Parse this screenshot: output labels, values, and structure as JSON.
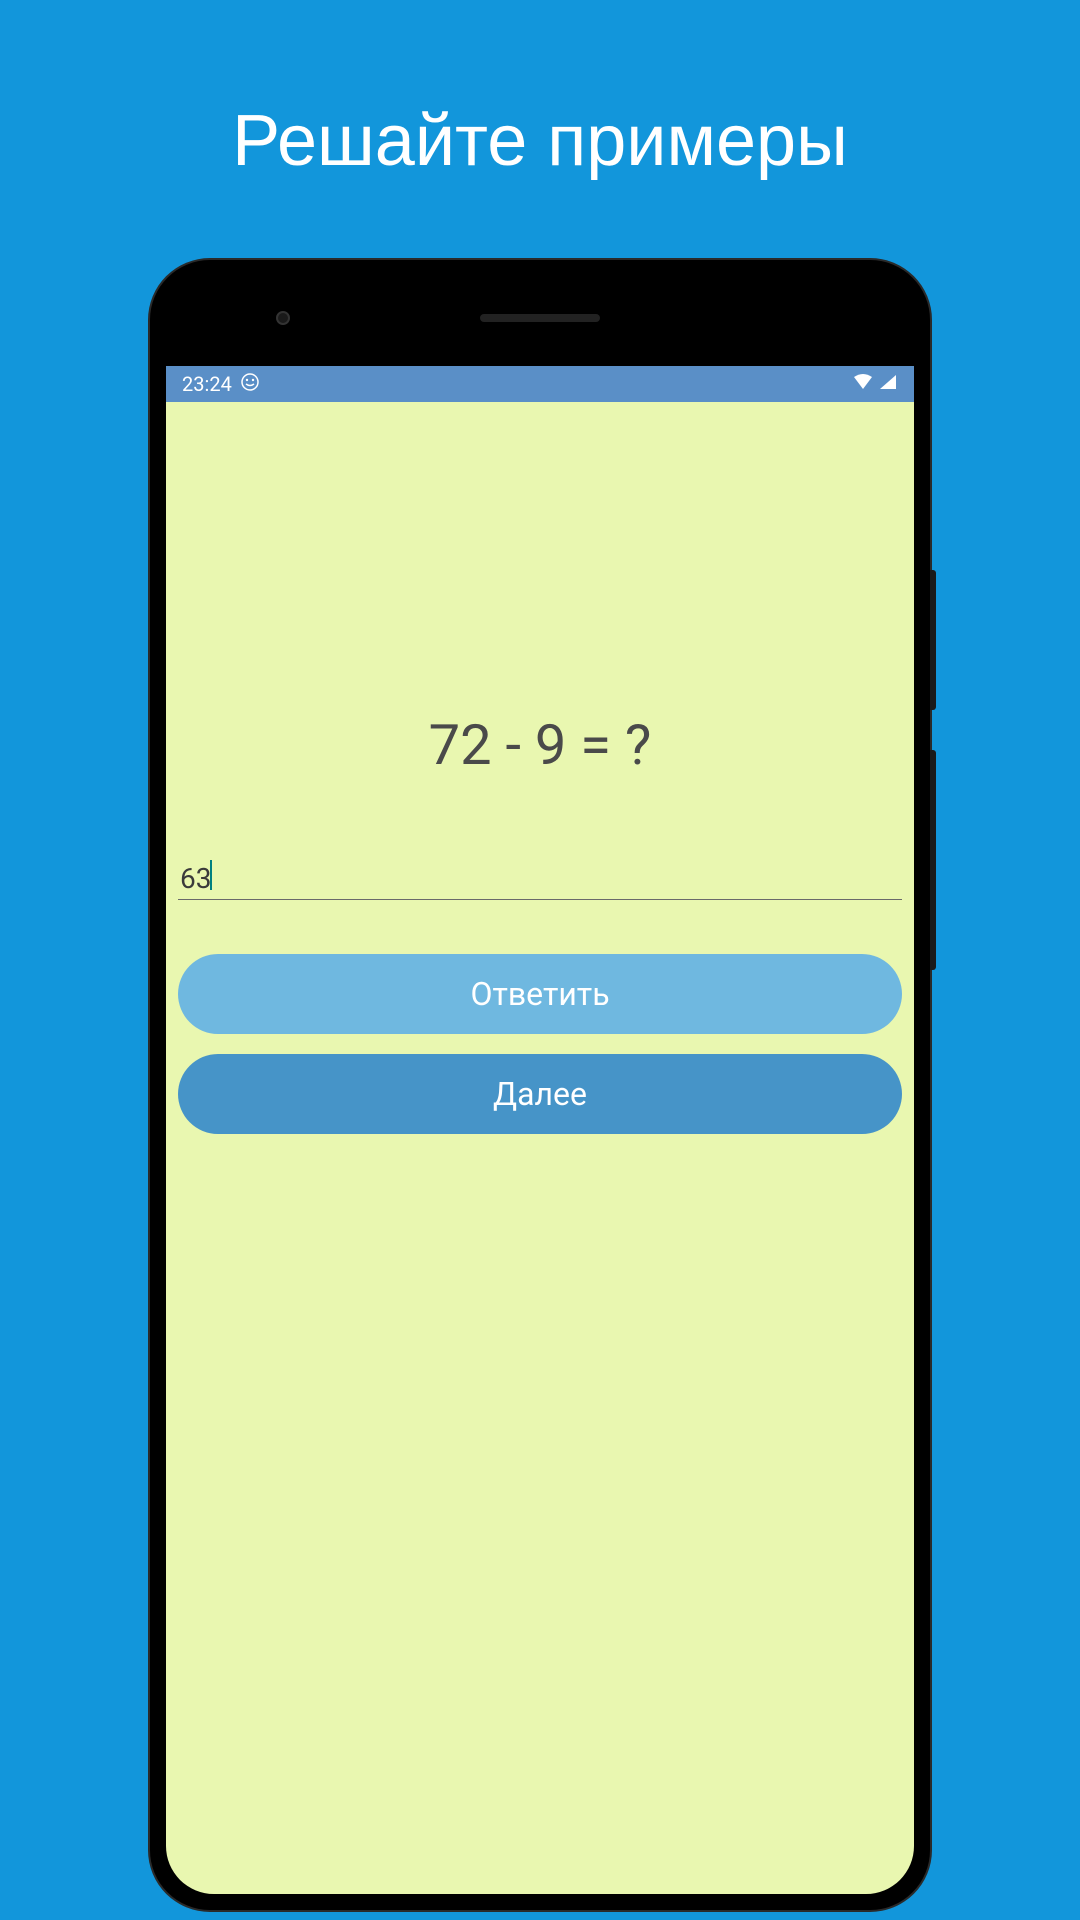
{
  "page": {
    "title": "Решайте примеры"
  },
  "statusBar": {
    "time": "23:24"
  },
  "app": {
    "question": "72 - 9 = ?",
    "answerValue": "63",
    "buttons": {
      "answer": "Ответить",
      "next": "Далее"
    }
  }
}
